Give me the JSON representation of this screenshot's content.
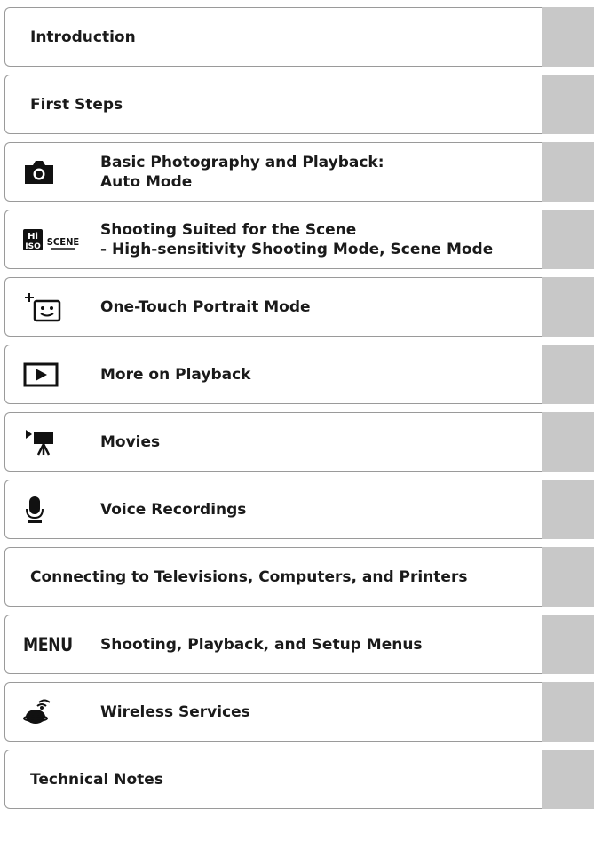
{
  "toc": {
    "items": [
      {
        "label": "Introduction",
        "icon": null
      },
      {
        "label": "First Steps",
        "icon": null
      },
      {
        "label": "Basic Photography and Playback:\nAuto Mode",
        "icon": "camera-icon"
      },
      {
        "label": "Shooting Suited for the Scene\n- High-sensitivity Shooting Mode, Scene Mode",
        "icon": "hi-iso-scene-icon"
      },
      {
        "label": "One-Touch Portrait Mode",
        "icon": "portrait-face-icon"
      },
      {
        "label": "More on Playback",
        "icon": "playback-icon"
      },
      {
        "label": "Movies",
        "icon": "movie-camera-icon"
      },
      {
        "label": "Voice Recordings",
        "icon": "microphone-icon"
      },
      {
        "label": "Connecting to Televisions, Computers, and Printers",
        "icon": null
      },
      {
        "label": "Shooting, Playback, and Setup Menus",
        "icon": "menu-icon",
        "icon_text": "MENU"
      },
      {
        "label": "Wireless Services",
        "icon": "wireless-icon"
      },
      {
        "label": "Technical Notes",
        "icon": null
      }
    ]
  },
  "colors": {
    "tab": "#c8c8c8",
    "border": "#9a9a9a",
    "text": "#1a1a1a"
  }
}
